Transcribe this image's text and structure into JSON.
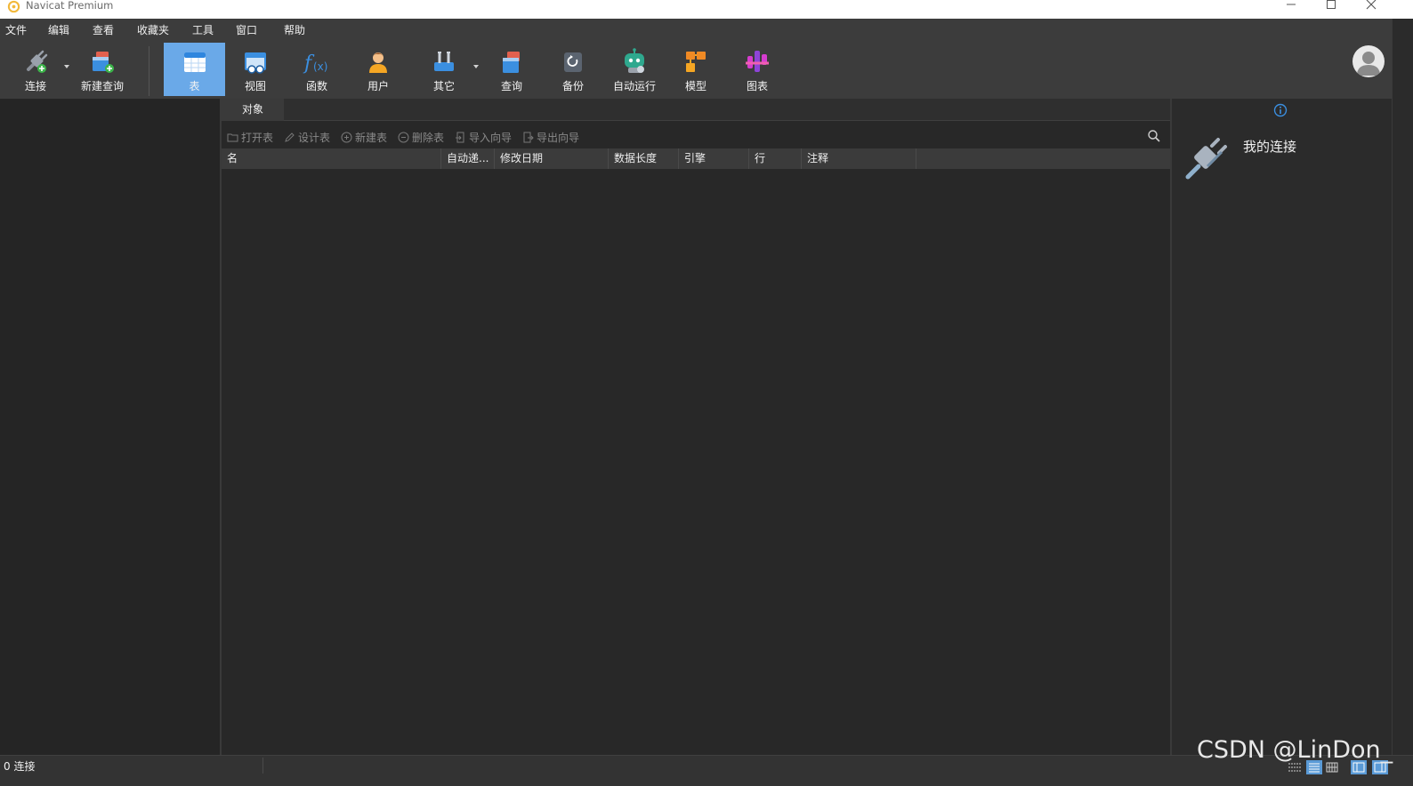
{
  "window": {
    "title": "Navicat Premium"
  },
  "menu": [
    "文件",
    "编辑",
    "查看",
    "收藏夹",
    "工具",
    "窗口",
    "帮助"
  ],
  "toolbar": {
    "connect": "连接",
    "new_query": "新建查询",
    "table": "表",
    "view": "视图",
    "function": "函数",
    "user": "用户",
    "other": "其它",
    "query": "查询",
    "backup": "备份",
    "automation": "自动运行",
    "model": "模型",
    "chart": "图表"
  },
  "center": {
    "tab_label": "对象",
    "actions": {
      "open_table": "打开表",
      "design_table": "设计表",
      "new_table": "新建表",
      "delete_table": "删除表",
      "import_wizard": "导入向导",
      "export_wizard": "导出向导"
    },
    "columns": [
      "名",
      "自动递...",
      "修改日期",
      "数据长度",
      "引擎",
      "行",
      "注释"
    ]
  },
  "info_panel": {
    "title": "我的连接"
  },
  "status": {
    "connections": "0 连接"
  },
  "watermark": "CSDN @LinDon_",
  "colors": {
    "active_tool": "#6aa9e8",
    "background": "#2b2b2b",
    "info_blue": "#3b8fe0"
  }
}
